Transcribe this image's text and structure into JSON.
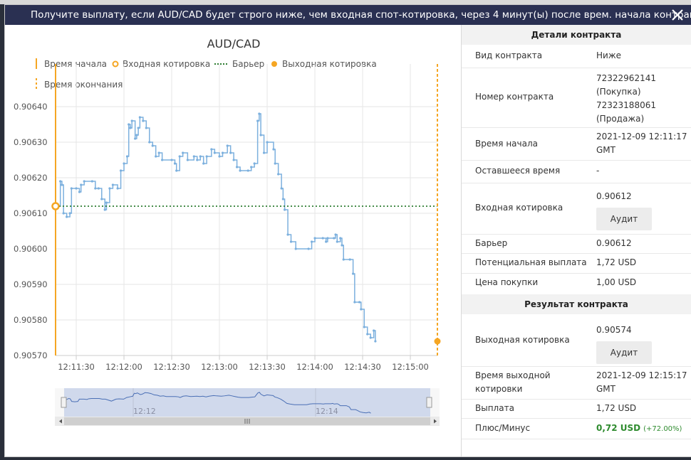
{
  "header": {
    "title": "Получите выплату, если AUD/CAD будет строго ниже, чем входная спот-котировка, через 4 минут(ы) после врем. начала контракта."
  },
  "colors": {
    "header_bg": "#2a3052",
    "accent": "#f5a623",
    "line": "#7cb0de",
    "barrier": "#2e7d32",
    "profit": "#2e8b2e"
  },
  "chart": {
    "title": "AUD/CAD",
    "legend": {
      "start": "Время начала",
      "entry": "Входная котировка",
      "barrier": "Барьер",
      "exit": "Выходная котировка",
      "end": "Время окончания"
    },
    "navigator": {
      "tick_1": "12:12",
      "tick_2": "12:14"
    }
  },
  "chart_data": {
    "type": "line",
    "title": "AUD/CAD",
    "x_ticks": [
      "12:11:30",
      "12:12:00",
      "12:12:30",
      "12:13:00",
      "12:13:30",
      "12:14:00",
      "12:14:30",
      "12:15:00"
    ],
    "y_ticks": [
      "0.90570",
      "0.90580",
      "0.90590",
      "0.90600",
      "0.90610",
      "0.90620",
      "0.90630",
      "0.90640"
    ],
    "ylim": [
      0.9057,
      0.90644
    ],
    "x_start": "12:11:17",
    "x_end": "12:15:17",
    "barrier": 0.90612,
    "entry": {
      "time": "12:11:17",
      "value": 0.90612
    },
    "exit": {
      "time": "12:15:17",
      "value": 0.90574
    },
    "series": [
      {
        "values": [
          [
            "12:11:17",
            0.90612
          ],
          [
            "12:11:20",
            0.90619
          ],
          [
            "12:11:21",
            0.90618
          ],
          [
            "12:11:22",
            0.9061
          ],
          [
            "12:11:24",
            0.90609
          ],
          [
            "12:11:26",
            0.9061
          ],
          [
            "12:11:27",
            0.90617
          ],
          [
            "12:11:30",
            0.90617
          ],
          [
            "12:11:32",
            0.90616
          ],
          [
            "12:11:33",
            0.90618
          ],
          [
            "12:11:35",
            0.90619
          ],
          [
            "12:11:40",
            0.90619
          ],
          [
            "12:11:42",
            0.90617
          ],
          [
            "12:11:44",
            0.90617
          ],
          [
            "12:11:46",
            0.90614
          ],
          [
            "12:11:48",
            0.90611
          ],
          [
            "12:11:49",
            0.90613
          ],
          [
            "12:11:51",
            0.90617
          ],
          [
            "12:11:53",
            0.90618
          ],
          [
            "12:11:56",
            0.90617
          ],
          [
            "12:11:58",
            0.90622
          ],
          [
            "12:12:00",
            0.90624
          ],
          [
            "12:12:02",
            0.90626
          ],
          [
            "12:12:03",
            0.90635
          ],
          [
            "12:12:04",
            0.90634
          ],
          [
            "12:12:05",
            0.90636
          ],
          [
            "12:12:07",
            0.90631
          ],
          [
            "12:12:08",
            0.90632
          ],
          [
            "12:12:09",
            0.90634
          ],
          [
            "12:12:10",
            0.90637
          ],
          [
            "12:12:12",
            0.90636
          ],
          [
            "12:12:14",
            0.90634
          ],
          [
            "12:12:16",
            0.9063
          ],
          [
            "12:12:18",
            0.90629
          ],
          [
            "12:12:20",
            0.90626
          ],
          [
            "12:12:22",
            0.90627
          ],
          [
            "12:12:24",
            0.90625
          ],
          [
            "12:12:30",
            0.90625
          ],
          [
            "12:12:32",
            0.90624
          ],
          [
            "12:12:33",
            0.90622
          ],
          [
            "12:12:35",
            0.90626
          ],
          [
            "12:12:37",
            0.90627
          ],
          [
            "12:12:40",
            0.90625
          ],
          [
            "12:12:44",
            0.90626
          ],
          [
            "12:12:46",
            0.90625
          ],
          [
            "12:12:48",
            0.90626
          ],
          [
            "12:12:50",
            0.90624
          ],
          [
            "12:12:52",
            0.90626
          ],
          [
            "12:12:55",
            0.90628
          ],
          [
            "12:12:57",
            0.90627
          ],
          [
            "12:13:00",
            0.90626
          ],
          [
            "12:13:02",
            0.90627
          ],
          [
            "12:13:05",
            0.90629
          ],
          [
            "12:13:07",
            0.90627
          ],
          [
            "12:13:09",
            0.90625
          ],
          [
            "12:13:11",
            0.90623
          ],
          [
            "12:13:13",
            0.90622
          ],
          [
            "12:13:18",
            0.90622
          ],
          [
            "12:13:20",
            0.90623
          ],
          [
            "12:13:22",
            0.90624
          ],
          [
            "12:13:24",
            0.90636
          ],
          [
            "12:13:25",
            0.90638
          ],
          [
            "12:13:26",
            0.90632
          ],
          [
            "12:13:28",
            0.90627
          ],
          [
            "12:13:30",
            0.9063
          ],
          [
            "12:13:34",
            0.90628
          ],
          [
            "12:13:35",
            0.90624
          ],
          [
            "12:13:37",
            0.90621
          ],
          [
            "12:13:39",
            0.90617
          ],
          [
            "12:13:40",
            0.90614
          ],
          [
            "12:13:41",
            0.90611
          ],
          [
            "12:13:43",
            0.90604
          ],
          [
            "12:13:45",
            0.90602
          ],
          [
            "12:13:48",
            0.906
          ],
          [
            "12:13:56",
            0.906
          ],
          [
            "12:13:58",
            0.90602
          ],
          [
            "12:14:00",
            0.90603
          ],
          [
            "12:14:05",
            0.90603
          ],
          [
            "12:14:07",
            0.90602
          ],
          [
            "12:14:08",
            0.90603
          ],
          [
            "12:14:12",
            0.90603
          ],
          [
            "12:14:13",
            0.90604
          ],
          [
            "12:14:14",
            0.90602
          ],
          [
            "12:14:16",
            0.90603
          ],
          [
            "12:14:17",
            0.90601
          ],
          [
            "12:14:18",
            0.90597
          ],
          [
            "12:14:22",
            0.90597
          ],
          [
            "12:14:24",
            0.90593
          ],
          [
            "12:14:25",
            0.90585
          ],
          [
            "12:14:28",
            0.90585
          ],
          [
            "12:14:29",
            0.90583
          ],
          [
            "12:14:31",
            0.90578
          ],
          [
            "12:14:33",
            0.90576
          ],
          [
            "12:14:35",
            0.90575
          ],
          [
            "12:14:37",
            0.90577
          ],
          [
            "12:14:38",
            0.90574
          ]
        ]
      }
    ]
  },
  "details": {
    "section_title": "Детали контракта",
    "rows": [
      {
        "label": "Вид контракта",
        "value": "Ниже"
      },
      {
        "label": "Номер контракта",
        "value_lines": [
          "72322962141",
          "(Покупка)",
          "72323188061",
          "(Продажа)"
        ]
      },
      {
        "label": "Время начала",
        "value_lines": [
          "2021-12-09 12:11:17",
          "GMT"
        ]
      },
      {
        "label": "Оставшееся время",
        "value": "-"
      },
      {
        "label": "Входная котировка",
        "value": "0.90612",
        "button": "Аудит"
      },
      {
        "label": "Барьер",
        "value": "0.90612"
      },
      {
        "label": "Потенциальная выплата",
        "value": "1,72 USD"
      },
      {
        "label": "Цена покупки",
        "value": "1,00 USD"
      }
    ]
  },
  "result": {
    "section_title": "Результат контракта",
    "exit_label": "Выходная котировка",
    "exit_value": "0.90574",
    "exit_button": "Аудит",
    "exit_time_label_lines": [
      "Время выходной",
      "котировки"
    ],
    "exit_time_lines": [
      "2021-12-09 12:15:17",
      "GMT"
    ],
    "payout_label": "Выплата",
    "payout_value": "1,72 USD",
    "pl_label": "Плюс/Минус",
    "pl_value": "0,72 USD",
    "pl_pct": "(+72.00%)"
  }
}
